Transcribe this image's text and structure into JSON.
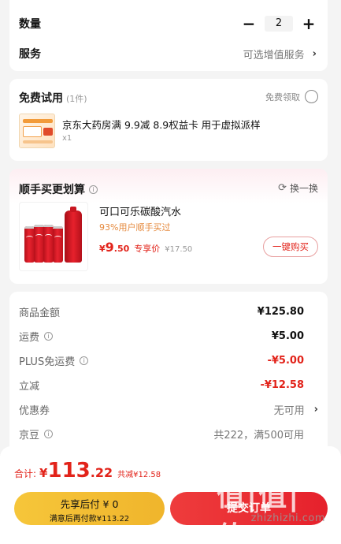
{
  "quantity_row": {
    "label": "数量",
    "minus": "−",
    "value": "2",
    "plus": "+"
  },
  "service_row": {
    "label": "服务",
    "value": "可选增值服务",
    "chevron": "›"
  },
  "free_trial": {
    "title": "免费试用",
    "count": "(1件)",
    "claim_label": "免费领取",
    "item_name": "京东大药房满 9.9减 8.9权益卡 用于虚拟派样",
    "item_qty": "x1"
  },
  "addon": {
    "title": "顺手买更划算",
    "info_icon": "ⓘ",
    "swap_icon": "⟳",
    "swap_label": "换一换",
    "product_name": "可口可乐碳酸汽水",
    "buy_rate": "93%用户顺手买过",
    "price_symbol": "¥",
    "price_int": "9",
    "price_dec": ".50",
    "price_tag": "专享价",
    "price_old": "¥17.50",
    "buy_button": "一键购买"
  },
  "summary": {
    "rows": [
      {
        "label": "商品金额",
        "value": "¥125.80",
        "info": ""
      },
      {
        "label": "运费",
        "value": "¥5.00",
        "info": "ⓘ"
      },
      {
        "label": "PLUS免运费",
        "value": "-¥5.00",
        "info": "ⓘ"
      },
      {
        "label": "立减",
        "value": "-¥12.58",
        "info": ""
      },
      {
        "label": "优惠券",
        "value": "无可用",
        "info": "",
        "chevron": "›"
      },
      {
        "label": "京豆",
        "value": "共222，满500可用",
        "info": "ⓘ"
      }
    ]
  },
  "bottom_bar": {
    "total_label": "合计:",
    "total_yen": "¥",
    "total_int": "113",
    "total_dec": ".22",
    "total_save": "共减¥12.58",
    "pay_later_line1": "先享后付 ¥ 0",
    "pay_later_line2": "满意后再付款¥113.22",
    "submit_label": "提交订单"
  },
  "watermark": {
    "logo": "值|值|值",
    "url": "zhizhizhi.com"
  },
  "colors": {
    "accent_red": "#e2231a",
    "pay_later_yellow": "#f6c63a",
    "page_bg": "#f4f4f4"
  }
}
